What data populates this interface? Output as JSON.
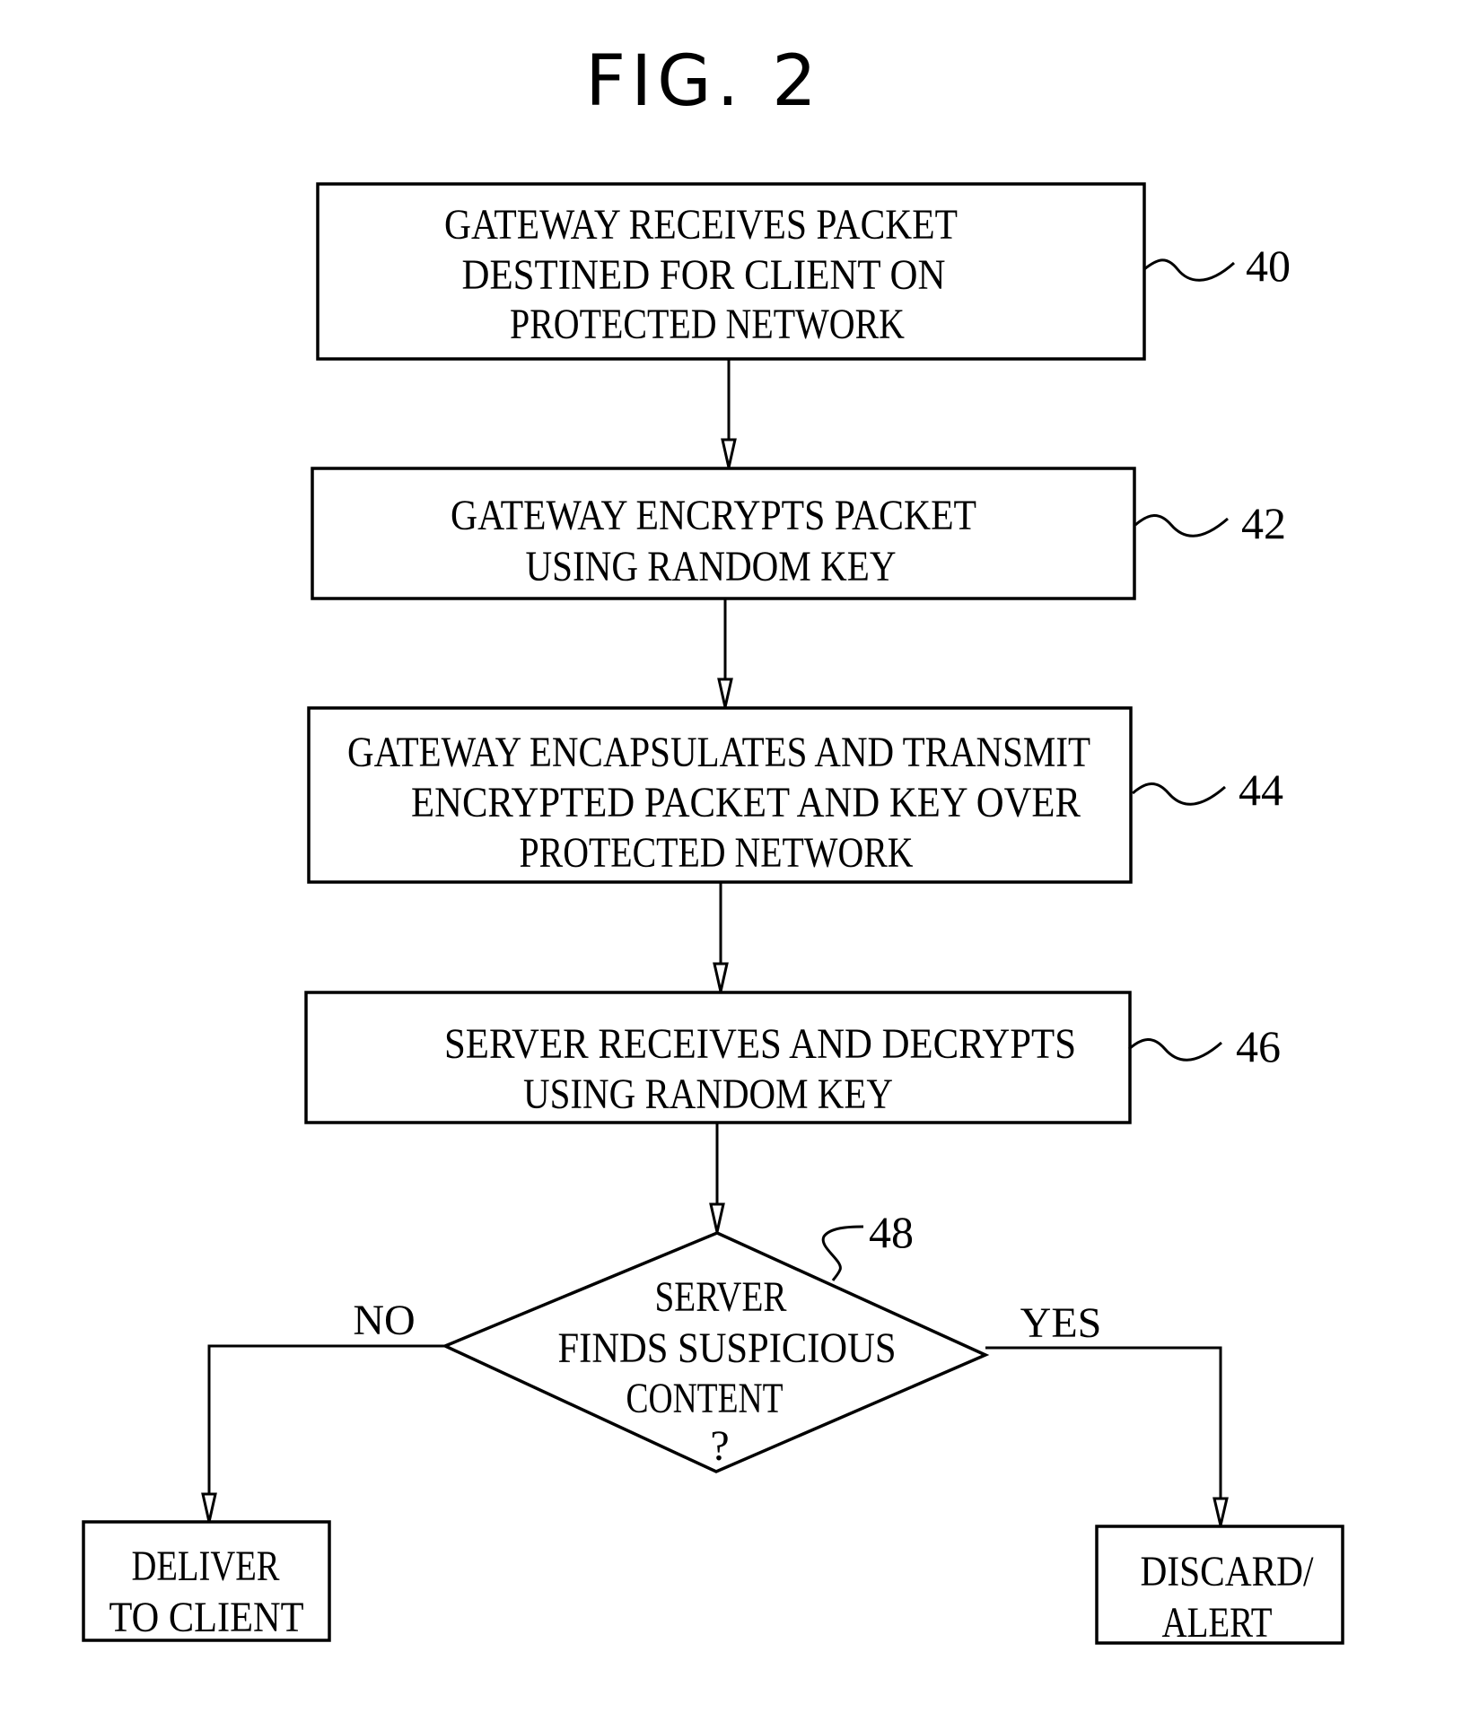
{
  "figure": {
    "title": "FIG. 2"
  },
  "steps": [
    {
      "ref": "40",
      "lines": [
        "GATEWAY  RECEIVES  PACKET",
        "DESTINED  FOR  CLIENT  ON",
        "PROTECTED  NETWORK"
      ]
    },
    {
      "ref": "42",
      "lines": [
        "GATEWAY  ENCRYPTS  PACKET",
        "USING  RANDOM  KEY"
      ]
    },
    {
      "ref": "44",
      "lines": [
        "GATEWAY  ENCAPSULATES  AND  TRANSMIT",
        "ENCRYPTED  PACKET  AND  KEY  OVER",
        "PROTECTED  NETWORK"
      ]
    },
    {
      "ref": "46",
      "lines": [
        "SERVER  RECEIVES  AND  DECRYPTS",
        "USING  RANDOM  KEY"
      ]
    }
  ],
  "decision": {
    "ref": "48",
    "lines": [
      "SERVER",
      "FINDS  SUSPICIOUS",
      "CONTENT",
      "?"
    ],
    "no_label": "NO",
    "yes_label": "YES"
  },
  "outcomes": {
    "no": {
      "lines": [
        "DELIVER",
        "TO  CLIENT"
      ]
    },
    "yes": {
      "lines": [
        "DISCARD/",
        "ALERT"
      ]
    }
  }
}
